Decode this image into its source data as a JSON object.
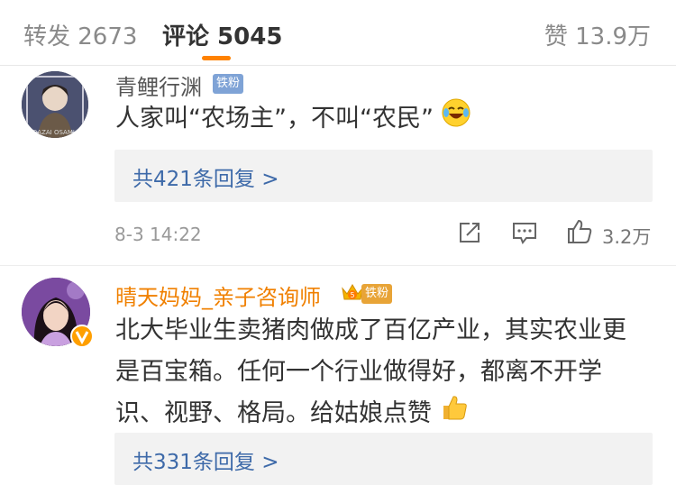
{
  "tabs": {
    "repost": "转发 2673",
    "comments": "评论 5045",
    "likes": "赞 13.9万"
  },
  "comments": [
    {
      "username": "青鲤行渊",
      "badge": "铁粉",
      "text": "人家叫“农场主”，不叫“农民”",
      "emoji": "laughing-crying-emoji",
      "replies": "共421条回复 >",
      "time": "8-3 14:22",
      "likes": "3.2万"
    },
    {
      "username": "晴天妈妈_亲子咨询师",
      "badge": "铁粉",
      "crown_level": "5",
      "text": "北大毕业生卖猪肉做成了百亿产业，其实农业更是百宝箱。任何一个行业做得好，都离不开学识、视野、格局。给姑娘点赞",
      "emoji": "thumbs-up-emoji",
      "replies": "共331条回复 >"
    }
  ],
  "colors": {
    "accent": "#ff8200",
    "link": "#3e6aa9",
    "vip_name": "#f08000",
    "fan_badge": "#7fa3d6"
  }
}
